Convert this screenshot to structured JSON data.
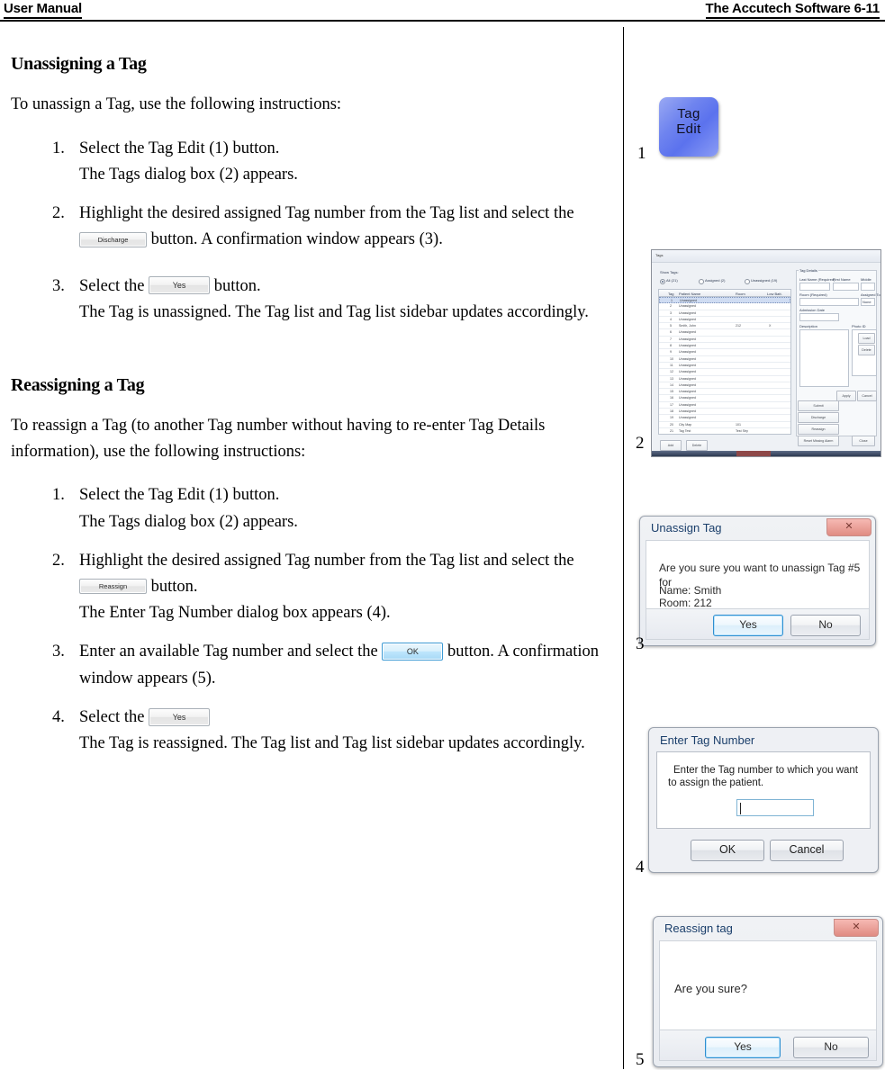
{
  "header": {
    "left": "User Manual",
    "right": "The Accutech Software 6-11"
  },
  "sections": [
    {
      "title": "Unassigning a Tag",
      "intro": "To unassign a Tag, use the following instructions:",
      "steps": [
        {
          "num": "1.",
          "line1": "Select the Tag Edit (1) button.",
          "line2": "The Tags dialog box (2) appears."
        },
        {
          "num": "2.",
          "text_before": "Highlight the desired assigned Tag number from the Tag list and select the ",
          "button_label": "Discharge",
          "text_after": " button. A confirmation window appears (3)."
        },
        {
          "num": "3.",
          "text_before": "Select the ",
          "button_label": "Yes",
          "text_after": " button.",
          "line2": "The Tag is unassigned. The Tag list and Tag list sidebar updates accordingly."
        }
      ]
    },
    {
      "title": "Reassigning a Tag",
      "intro": "To reassign a Tag (to another Tag number without having to re-enter Tag Details information), use the following instructions:",
      "steps": [
        {
          "num": "1.",
          "line1": "Select the Tag Edit (1) button.",
          "line2": "The Tags dialog box (2) appears."
        },
        {
          "num": "2.",
          "text_before": "Highlight the desired assigned Tag number from the Tag list and select the ",
          "button_label": "Reassign",
          "text_after": " button.",
          "line2": "The Enter Tag Number dialog box appears (4)."
        },
        {
          "num": "3.",
          "text_before": "Enter an available Tag number and select the ",
          "button_label": "OK",
          "text_after": " button. A confirmation window appears (5)."
        },
        {
          "num": "4.",
          "text_before": "Select the ",
          "button_label": "Yes",
          "text_after": "",
          "line2": "The Tag is reassigned. The Tag list and Tag list sidebar updates accordingly."
        }
      ]
    }
  ],
  "figures": {
    "fig1": {
      "number": "1",
      "button_line1": "Tag",
      "button_line2": "Edit"
    },
    "fig2": {
      "number": "2",
      "window_title": "Tags",
      "show_tags_label": "Show Tags:",
      "radios": [
        {
          "label": "All (21)",
          "selected": true
        },
        {
          "label": "Assigned (2)",
          "selected": false
        },
        {
          "label": "Unassigned (19)",
          "selected": false
        }
      ],
      "list_headers": [
        "Tag",
        "Patient Name",
        "Room",
        "Low Batt."
      ],
      "list_rows": [
        {
          "tag": "1",
          "name": "Unassigned",
          "room": "",
          "batt": ""
        },
        {
          "tag": "2",
          "name": "Unassigned",
          "room": "",
          "batt": ""
        },
        {
          "tag": "3",
          "name": "Unassigned",
          "room": "",
          "batt": ""
        },
        {
          "tag": "4",
          "name": "Unassigned",
          "room": "",
          "batt": ""
        },
        {
          "tag": "5",
          "name": "Smith, John",
          "room": "212",
          "batt": "X"
        },
        {
          "tag": "6",
          "name": "Unassigned",
          "room": "",
          "batt": ""
        },
        {
          "tag": "7",
          "name": "Unassigned",
          "room": "",
          "batt": ""
        },
        {
          "tag": "8",
          "name": "Unassigned",
          "room": "",
          "batt": ""
        },
        {
          "tag": "9",
          "name": "Unassigned",
          "room": "",
          "batt": ""
        },
        {
          "tag": "10",
          "name": "Unassigned",
          "room": "",
          "batt": ""
        },
        {
          "tag": "11",
          "name": "Unassigned",
          "room": "",
          "batt": ""
        },
        {
          "tag": "12",
          "name": "Unassigned",
          "room": "",
          "batt": ""
        },
        {
          "tag": "13",
          "name": "Unassigned",
          "room": "",
          "batt": ""
        },
        {
          "tag": "14",
          "name": "Unassigned",
          "room": "",
          "batt": ""
        },
        {
          "tag": "15",
          "name": "Unassigned",
          "room": "",
          "batt": ""
        },
        {
          "tag": "16",
          "name": "Unassigned",
          "room": "",
          "batt": ""
        },
        {
          "tag": "17",
          "name": "Unassigned",
          "room": "",
          "batt": ""
        },
        {
          "tag": "18",
          "name": "Unassigned",
          "room": "",
          "batt": ""
        },
        {
          "tag": "19",
          "name": "Unassigned",
          "room": "",
          "batt": ""
        },
        {
          "tag": "20",
          "name": "City Map",
          "room": "101",
          "batt": ""
        },
        {
          "tag": "21",
          "name": "Tag Test",
          "room": "Test Stry",
          "batt": ""
        }
      ],
      "details_group": "Tag Details",
      "field_labels": {
        "last_name": "Last Name (Required)",
        "first_name": "First Name",
        "middle": "Middle",
        "room": "Room (Required)",
        "assigned_to": "Assigned To",
        "admission_date": "Admission Date",
        "description": "Description",
        "photo_id": "Photo ID"
      },
      "assigned_to_value": "None",
      "detail_buttons": [
        "Load",
        "Delete"
      ],
      "detail_footer_buttons": [
        "Apply",
        "Cancel"
      ],
      "action_buttons": [
        "Submit",
        "Discharge",
        "Reassign",
        "Reset Missing Alarm"
      ],
      "close_button": "Close",
      "bottom_buttons": [
        "Add",
        "Delete"
      ]
    },
    "fig3": {
      "number": "3",
      "title": "Unassign Tag",
      "message": "Are you sure you want to unassign Tag #5 for",
      "name_line": "Name: Smith",
      "room_line": "Room: 212",
      "yes": "Yes",
      "no": "No",
      "close_glyph": "✕"
    },
    "fig4": {
      "number": "4",
      "title": "Enter Tag Number",
      "message_line1": "Enter the Tag number to which you want",
      "message_line2": "to assign the patient.",
      "input_value": "",
      "ok": "OK",
      "cancel": "Cancel"
    },
    "fig5": {
      "number": "5",
      "title": "Reassign tag",
      "message": "Are you sure?",
      "yes": "Yes",
      "no": "No",
      "close_glyph": "✕"
    }
  },
  "colors": {
    "tag_edit_blue": "#6f84ef",
    "focus_blue": "#2f8fd0",
    "close_red": "#e08b82"
  }
}
